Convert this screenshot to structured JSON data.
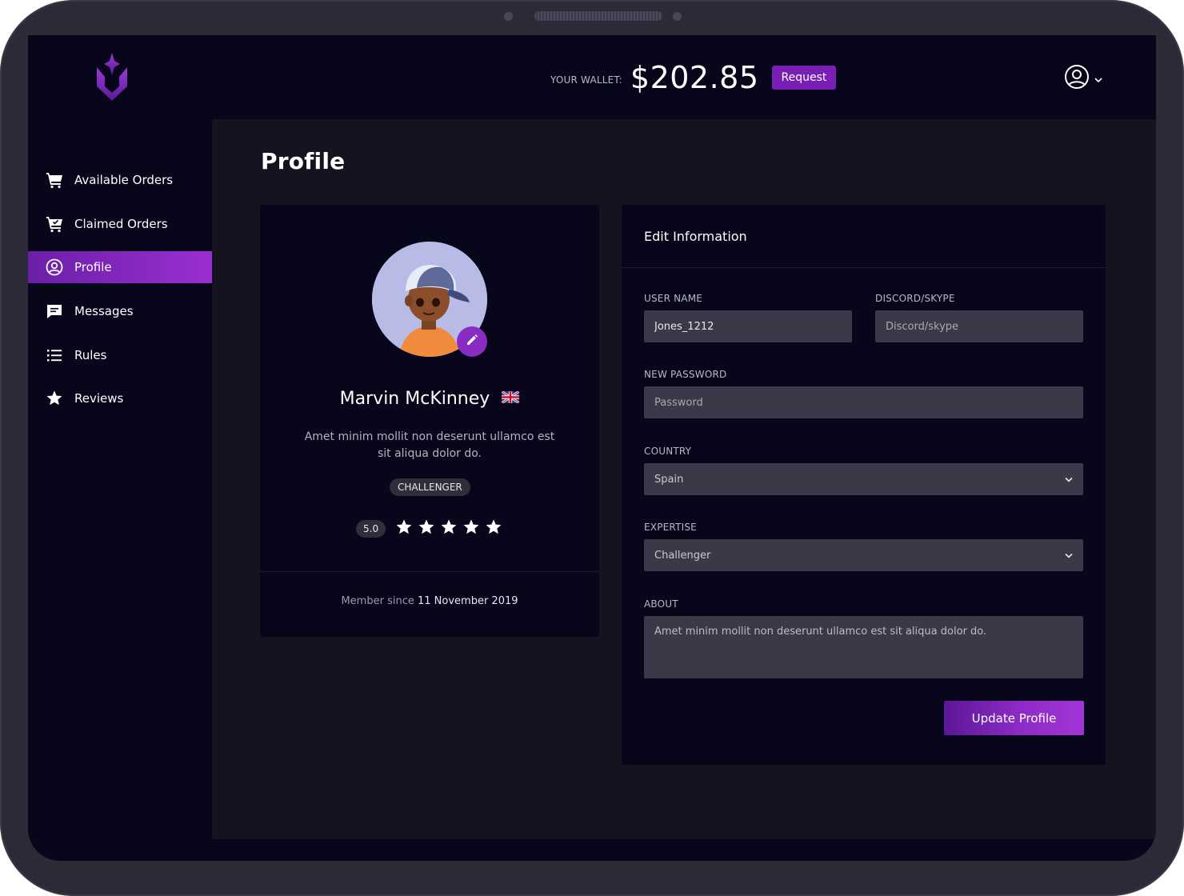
{
  "header": {
    "wallet_label": "YOUR WALLET:",
    "wallet_amount": "$202.85",
    "request_label": "Request"
  },
  "sidebar": {
    "items": [
      {
        "label": "Available Orders",
        "icon": "cart-icon"
      },
      {
        "label": "Claimed Orders",
        "icon": "cart-check-icon"
      },
      {
        "label": "Profile",
        "icon": "user-circle-icon",
        "active": true
      },
      {
        "label": "Messages",
        "icon": "message-icon"
      },
      {
        "label": "Rules",
        "icon": "list-icon"
      },
      {
        "label": "Reviews",
        "icon": "star-icon"
      }
    ]
  },
  "main": {
    "page_title": "Profile",
    "profile_card": {
      "name": "Marvin McKinney",
      "flag": "uk-flag-icon",
      "bio": "Amet minim mollit non deserunt ullamco est sit aliqua dolor do.",
      "rank": "CHALLENGER",
      "rating": "5.0",
      "stars": 5,
      "member_since_label": "Member since",
      "member_since_date": "11 November 2019"
    },
    "edit_form": {
      "title": "Edit Information",
      "username_label": "USER NAME",
      "username_value": "Jones_1212",
      "discord_label": "DISCORD/SKYPE",
      "discord_placeholder": "Discord/skype",
      "password_label": "NEW PASSWORD",
      "password_placeholder": "Password",
      "country_label": "COUNTRY",
      "country_value": "Spain",
      "expertise_label": "EXPERTISE",
      "expertise_value": "Challenger",
      "about_label": "ABOUT",
      "about_value": "Amet minim mollit non deserunt ullamco est sit aliqua dolor do.",
      "submit_label": "Update Profile"
    }
  },
  "colors": {
    "accent": "#8a2bc4",
    "background": "#07061a",
    "panel": "#15131f",
    "input": "#3a3947"
  }
}
